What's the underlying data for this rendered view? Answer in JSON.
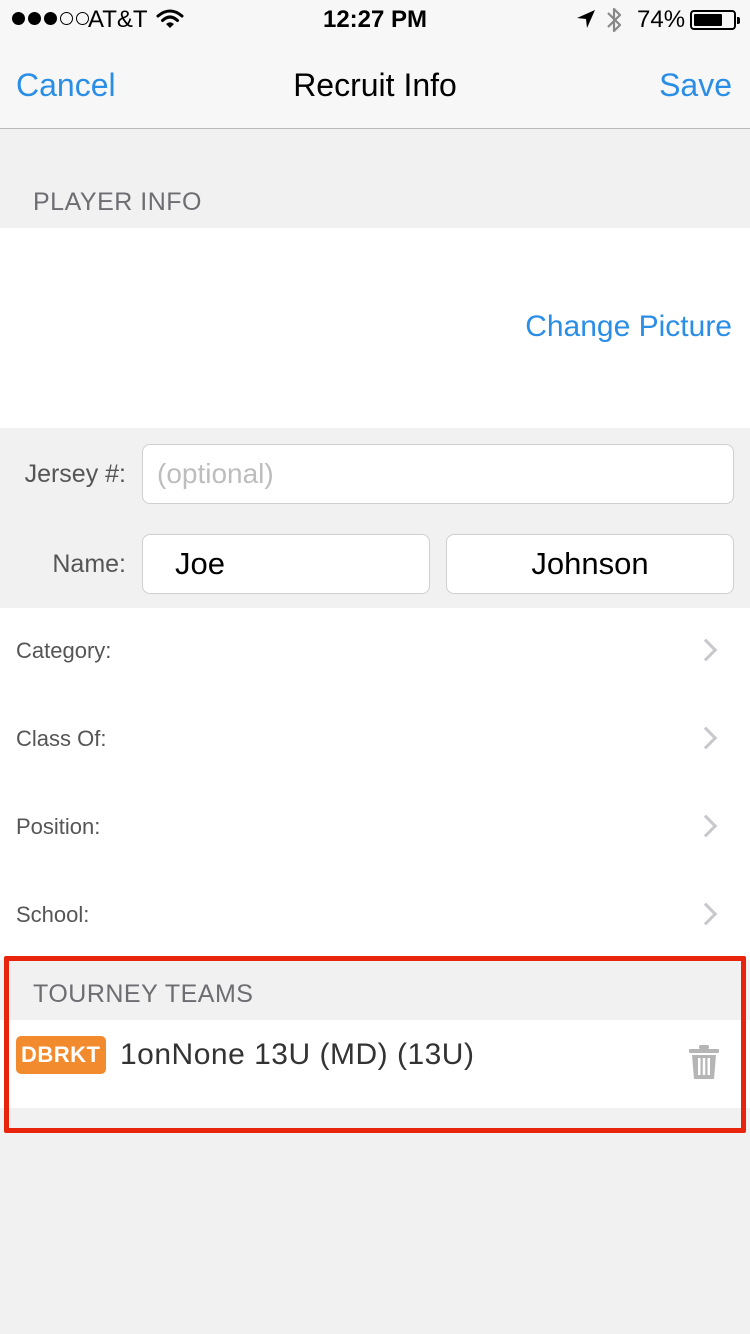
{
  "status_bar": {
    "carrier": "AT&T",
    "time": "12:27 PM",
    "battery_percent": "74%",
    "battery_level": 0.74,
    "signal_bars_filled": 3,
    "signal_bars_total": 5
  },
  "nav": {
    "cancel_label": "Cancel",
    "title": "Recruit Info",
    "save_label": "Save"
  },
  "player_info": {
    "header": "PLAYER INFO",
    "change_picture_label": "Change Picture",
    "jersey_label": "Jersey #:",
    "jersey_placeholder": "(optional)",
    "name_label": "Name:",
    "first_name": "Joe",
    "last_name": "Johnson"
  },
  "details": [
    {
      "label": "Category:"
    },
    {
      "label": "Class Of:"
    },
    {
      "label": "Position:"
    },
    {
      "label": "School:"
    }
  ],
  "tourney_teams": {
    "header": "TOURNEY TEAMS",
    "teams": [
      {
        "badge": "DBRKT",
        "name": "1onNone 13U (MD) (13U)"
      }
    ]
  },
  "colors": {
    "accent": "#2b8ee6",
    "highlight_border": "#e8250c",
    "badge": "#f28a2e"
  },
  "icons": [
    "wifi-icon",
    "location-arrow-icon",
    "bluetooth-icon",
    "battery-icon",
    "chevron-right-icon",
    "trash-icon"
  ]
}
